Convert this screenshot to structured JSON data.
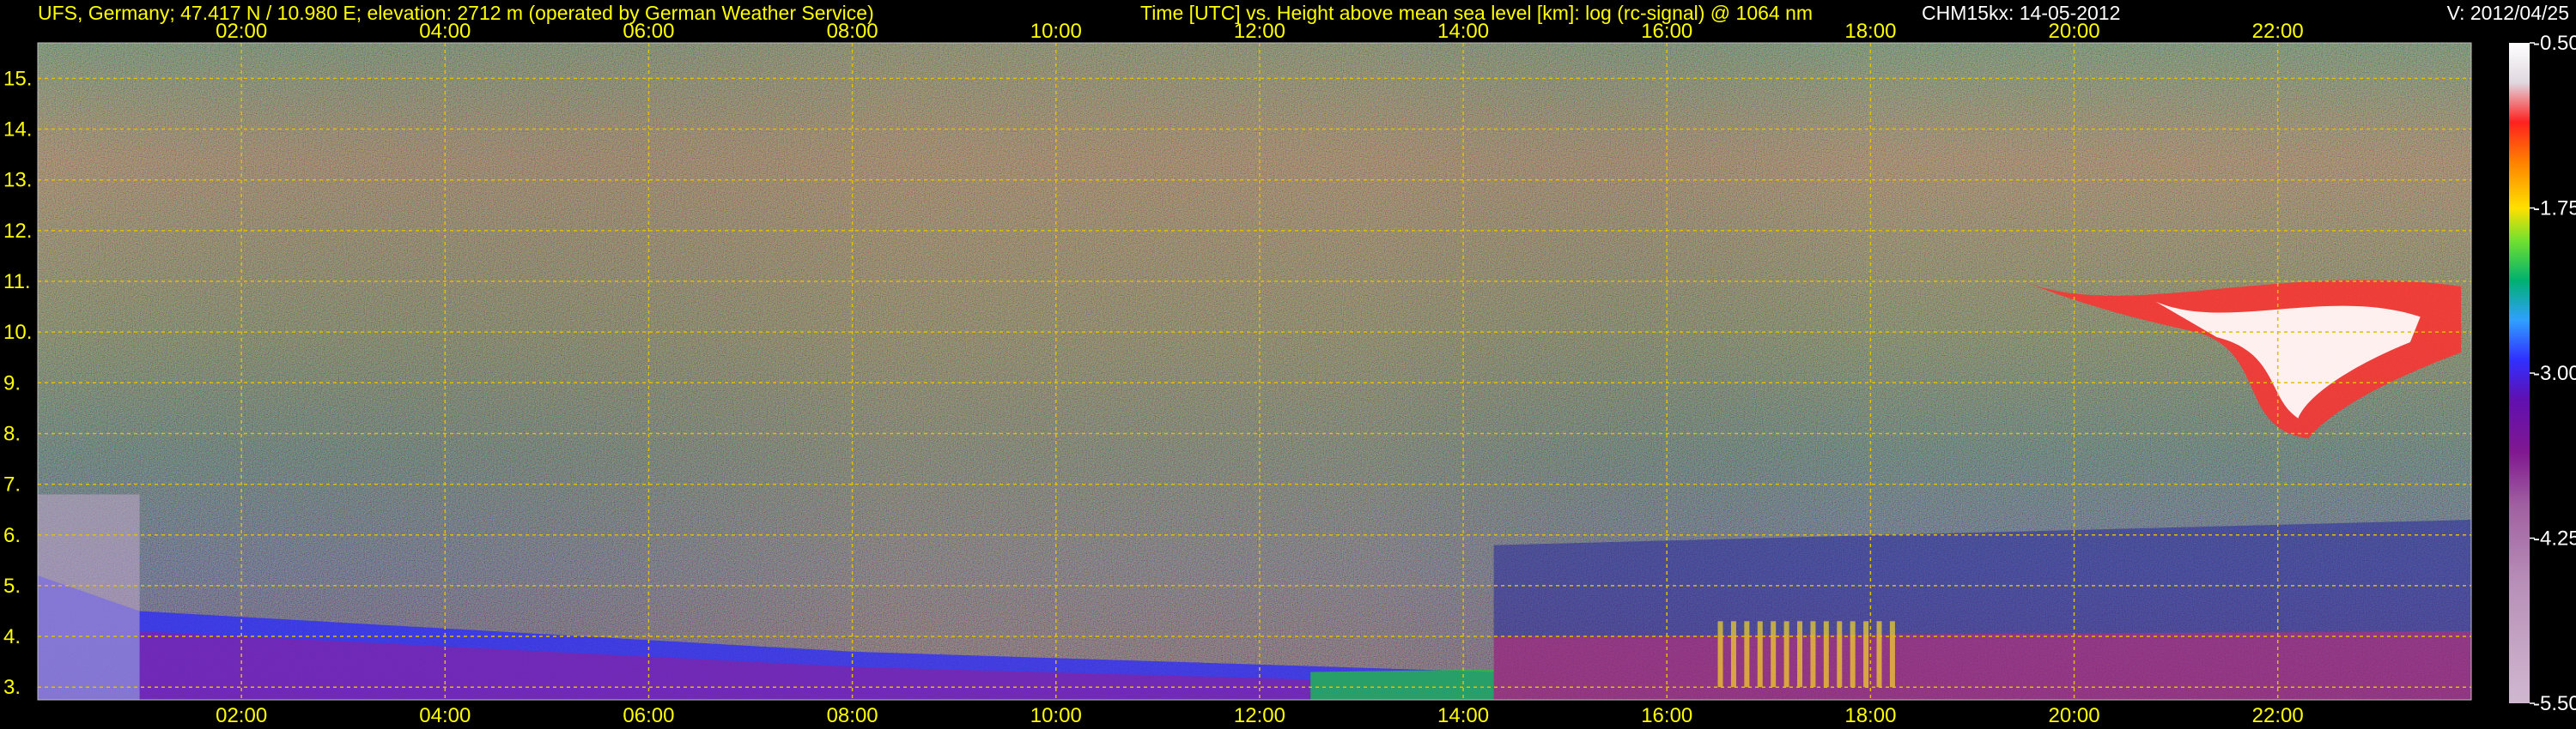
{
  "header": {
    "station": "UFS, Germany; 47.417 N / 10.980 E; elevation: 2712 m  (operated by German Weather Service)",
    "plot_title": "Time [UTC] vs. Height above mean sea level [km]: log (rc-signal) @ 1064 nm",
    "instrument_date": "CHM15kx: 14-05-2012",
    "version": "V: 2012/04/25"
  },
  "colors": {
    "background": "#000000",
    "header_text": "#ffff00",
    "axis_text": "#ffff00",
    "grid": "#e0c000",
    "colorbar_label": "#ffffff"
  },
  "chart_data": {
    "type": "heatmap",
    "title": "Time [UTC] vs. Height above mean sea level [km]: log (rc-signal) @ 1064 nm",
    "xlabel": "Time [UTC]",
    "ylabel": "Height above mean sea level [km]",
    "x_unit": "hours UTC",
    "xlim": [
      0.0,
      23.9
    ],
    "ylim": [
      2.75,
      15.7
    ],
    "x_ticks": [
      {
        "value": 2,
        "label": "02:00"
      },
      {
        "value": 4,
        "label": "04:00"
      },
      {
        "value": 6,
        "label": "06:00"
      },
      {
        "value": 8,
        "label": "08:00"
      },
      {
        "value": 10,
        "label": "10:00"
      },
      {
        "value": 12,
        "label": "12:00"
      },
      {
        "value": 14,
        "label": "14:00"
      },
      {
        "value": 16,
        "label": "16:00"
      },
      {
        "value": 18,
        "label": "18:00"
      },
      {
        "value": 20,
        "label": "20:00"
      },
      {
        "value": 22,
        "label": "22:00"
      }
    ],
    "y_ticks": [
      {
        "value": 3,
        "label": "3."
      },
      {
        "value": 4,
        "label": "4."
      },
      {
        "value": 5,
        "label": "5."
      },
      {
        "value": 6,
        "label": "6."
      },
      {
        "value": 7,
        "label": "7."
      },
      {
        "value": 8,
        "label": "8."
      },
      {
        "value": 9,
        "label": "9."
      },
      {
        "value": 10,
        "label": "10."
      },
      {
        "value": 11,
        "label": "11."
      },
      {
        "value": 12,
        "label": "12."
      },
      {
        "value": 13,
        "label": "13."
      },
      {
        "value": 14,
        "label": "14."
      },
      {
        "value": 15,
        "label": "15."
      }
    ],
    "grid": true,
    "colorbar": {
      "range": [
        -5.5,
        -0.5
      ],
      "ticks": [
        {
          "value": -0.5,
          "label": "-0.50"
        },
        {
          "value": -1.75,
          "label": "-1.75"
        },
        {
          "value": -3.0,
          "label": "-3.00"
        },
        {
          "value": -4.25,
          "label": "-4.25"
        },
        {
          "value": -5.5,
          "label": "-5.50"
        }
      ],
      "stops": [
        {
          "value": -0.5,
          "color": "#ffffff"
        },
        {
          "value": -0.8,
          "color": "#e0d8e0"
        },
        {
          "value": -1.1,
          "color": "#ff2020"
        },
        {
          "value": -1.4,
          "color": "#ff8000"
        },
        {
          "value": -1.75,
          "color": "#ffe000"
        },
        {
          "value": -2.0,
          "color": "#70e030"
        },
        {
          "value": -2.3,
          "color": "#00b070"
        },
        {
          "value": -2.6,
          "color": "#30a0ff"
        },
        {
          "value": -2.9,
          "color": "#3030ff"
        },
        {
          "value": -3.2,
          "color": "#6010b0"
        },
        {
          "value": -3.6,
          "color": "#801890"
        },
        {
          "value": -4.0,
          "color": "#a060a0"
        },
        {
          "value": -4.6,
          "color": "#b890b8"
        },
        {
          "value": -5.5,
          "color": "#d0b8d0"
        }
      ]
    }
  }
}
